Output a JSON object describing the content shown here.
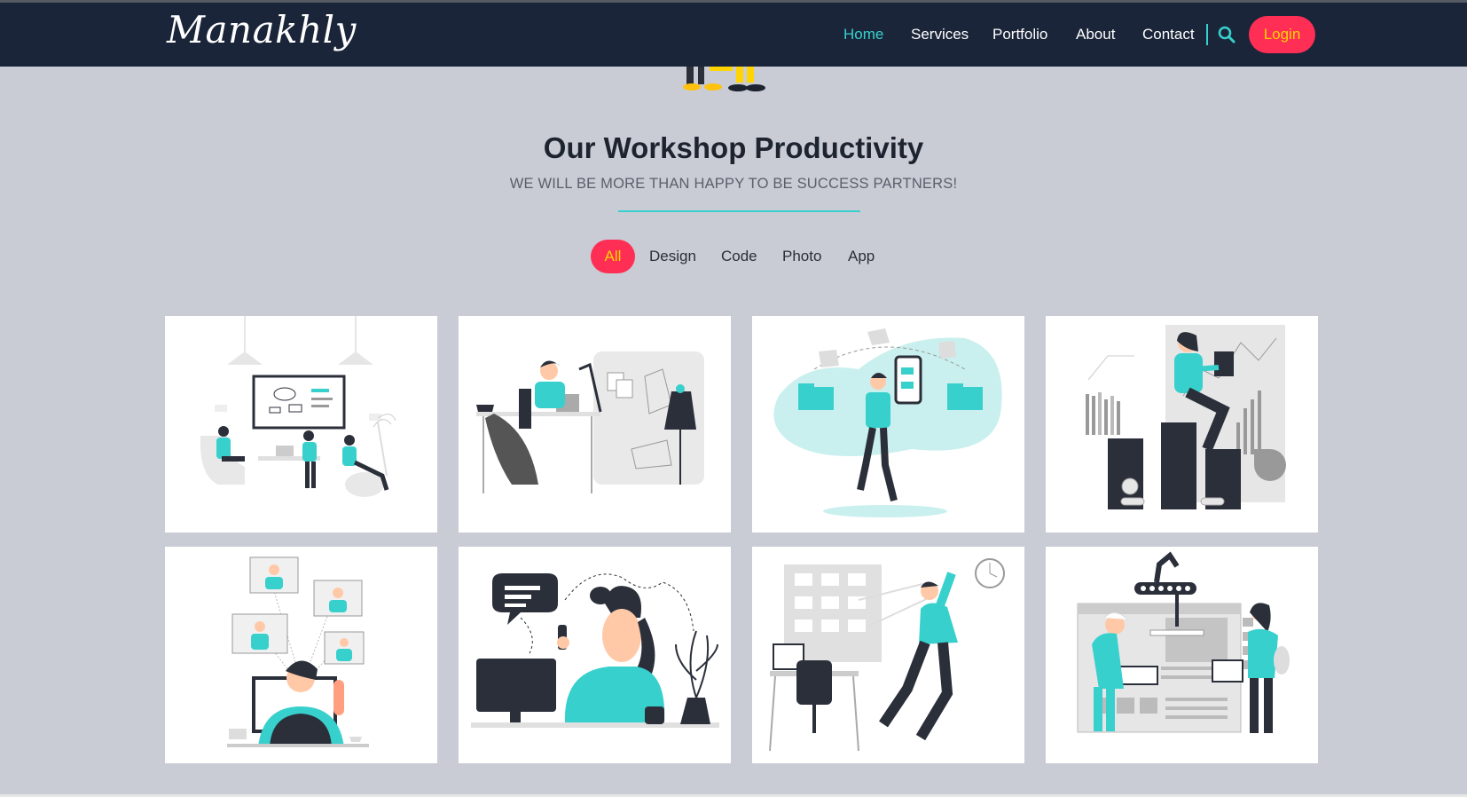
{
  "brand": {
    "logo_text": "Manakhly"
  },
  "nav": {
    "items": [
      {
        "label": "Home",
        "active": true
      },
      {
        "label": "Services",
        "active": false
      },
      {
        "label": "Portfolio",
        "active": false
      },
      {
        "label": "About",
        "active": false
      },
      {
        "label": "Contact",
        "active": false
      }
    ],
    "search_icon": "search-icon",
    "login_label": "Login"
  },
  "section": {
    "title": "Our Workshop Productivity",
    "subtitle": "WE WILL BE MORE THAN HAPPY TO BE SUCCESS PARTNERS!"
  },
  "filters": [
    {
      "label": "All",
      "active": true
    },
    {
      "label": "Design",
      "active": false
    },
    {
      "label": "Code",
      "active": false
    },
    {
      "label": "Photo",
      "active": false
    },
    {
      "label": "App",
      "active": false
    }
  ],
  "portfolio": {
    "items": [
      {
        "illustration": "team-meeting-illustration"
      },
      {
        "illustration": "tailor-sewing-illustration"
      },
      {
        "illustration": "mobile-file-transfer-illustration"
      },
      {
        "illustration": "business-growth-illustration"
      },
      {
        "illustration": "video-conference-illustration"
      },
      {
        "illustration": "phone-call-illustration"
      },
      {
        "illustration": "task-board-illustration"
      },
      {
        "illustration": "web-factory-illustration"
      }
    ]
  },
  "colors": {
    "navbar": "#1a2539",
    "accent": "#38d0cd",
    "login_bg": "#ff2e55",
    "login_text": "#ffd400",
    "page_bg": "#c9ccd5"
  }
}
